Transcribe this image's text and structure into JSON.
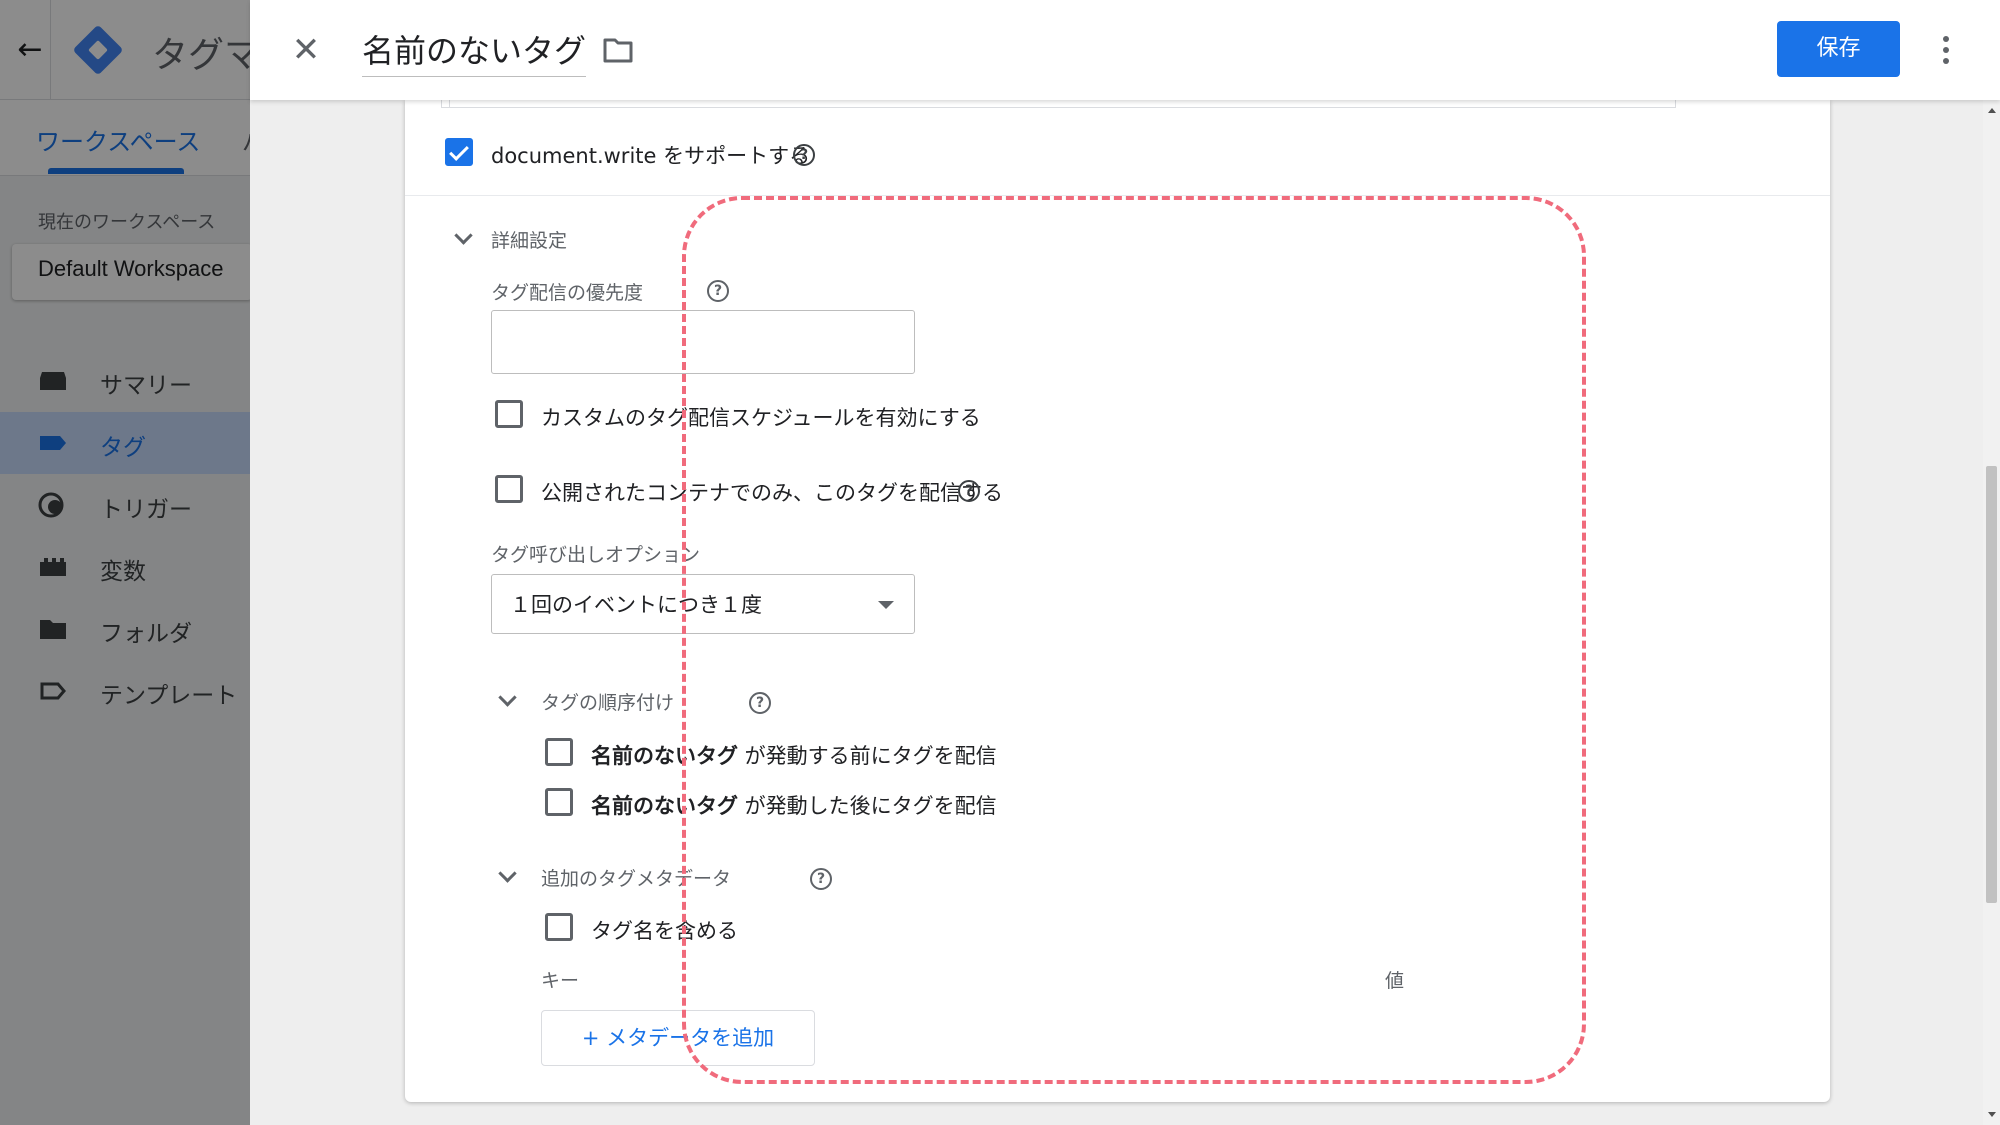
{
  "background": {
    "back_icon": "arrow-left-icon",
    "app_title": "タグマ",
    "tabs": [
      "ワークスペース",
      "バ"
    ],
    "workspace_label": "現在のワークスペース",
    "workspace_name": "Default Workspace",
    "nav": [
      {
        "label": "サマリー",
        "icon": "summary-icon"
      },
      {
        "label": "タグ",
        "icon": "tag-icon",
        "active": true
      },
      {
        "label": "トリガー",
        "icon": "trigger-icon"
      },
      {
        "label": "変数",
        "icon": "variables-icon"
      },
      {
        "label": "フォルダ",
        "icon": "folder-icon"
      },
      {
        "label": "テンプレート",
        "icon": "template-icon"
      }
    ]
  },
  "header": {
    "close_icon": "close-icon",
    "title": "名前のないタグ",
    "folder_icon": "folder-icon",
    "save_label": "保存",
    "more_icon": "more-vert-icon"
  },
  "settings": {
    "document_write": {
      "label": "document.write をサポートする",
      "checked": true
    },
    "advanced": {
      "title": "詳細設定",
      "priority_label": "タグ配信の優先度",
      "priority_value": "",
      "custom_schedule": {
        "label": "カスタムのタグ配信スケジュールを有効にする",
        "checked": false
      },
      "published_only": {
        "label": "公開されたコンテナでのみ、このタグを配信する",
        "checked": false
      },
      "firing_options_label": "タグ呼び出しオプション",
      "firing_options_value": "１回のイベントにつき１度",
      "sequencing": {
        "title": "タグの順序付け",
        "setup": {
          "tag_name": "名前のないタグ",
          "suffix": " が発動する前にタグを配信",
          "checked": false
        },
        "cleanup": {
          "tag_name": "名前のないタグ",
          "suffix": " が発動した後にタグを配信",
          "checked": false
        }
      },
      "metadata": {
        "title": "追加のタグメタデータ",
        "include_name": {
          "label": "タグ名を含める",
          "checked": false
        },
        "key_header": "キー",
        "value_header": "値",
        "add_label": "+ メタデータを追加"
      }
    }
  },
  "colors": {
    "accent": "#1a73e8",
    "highlight": "#f06b7c"
  }
}
